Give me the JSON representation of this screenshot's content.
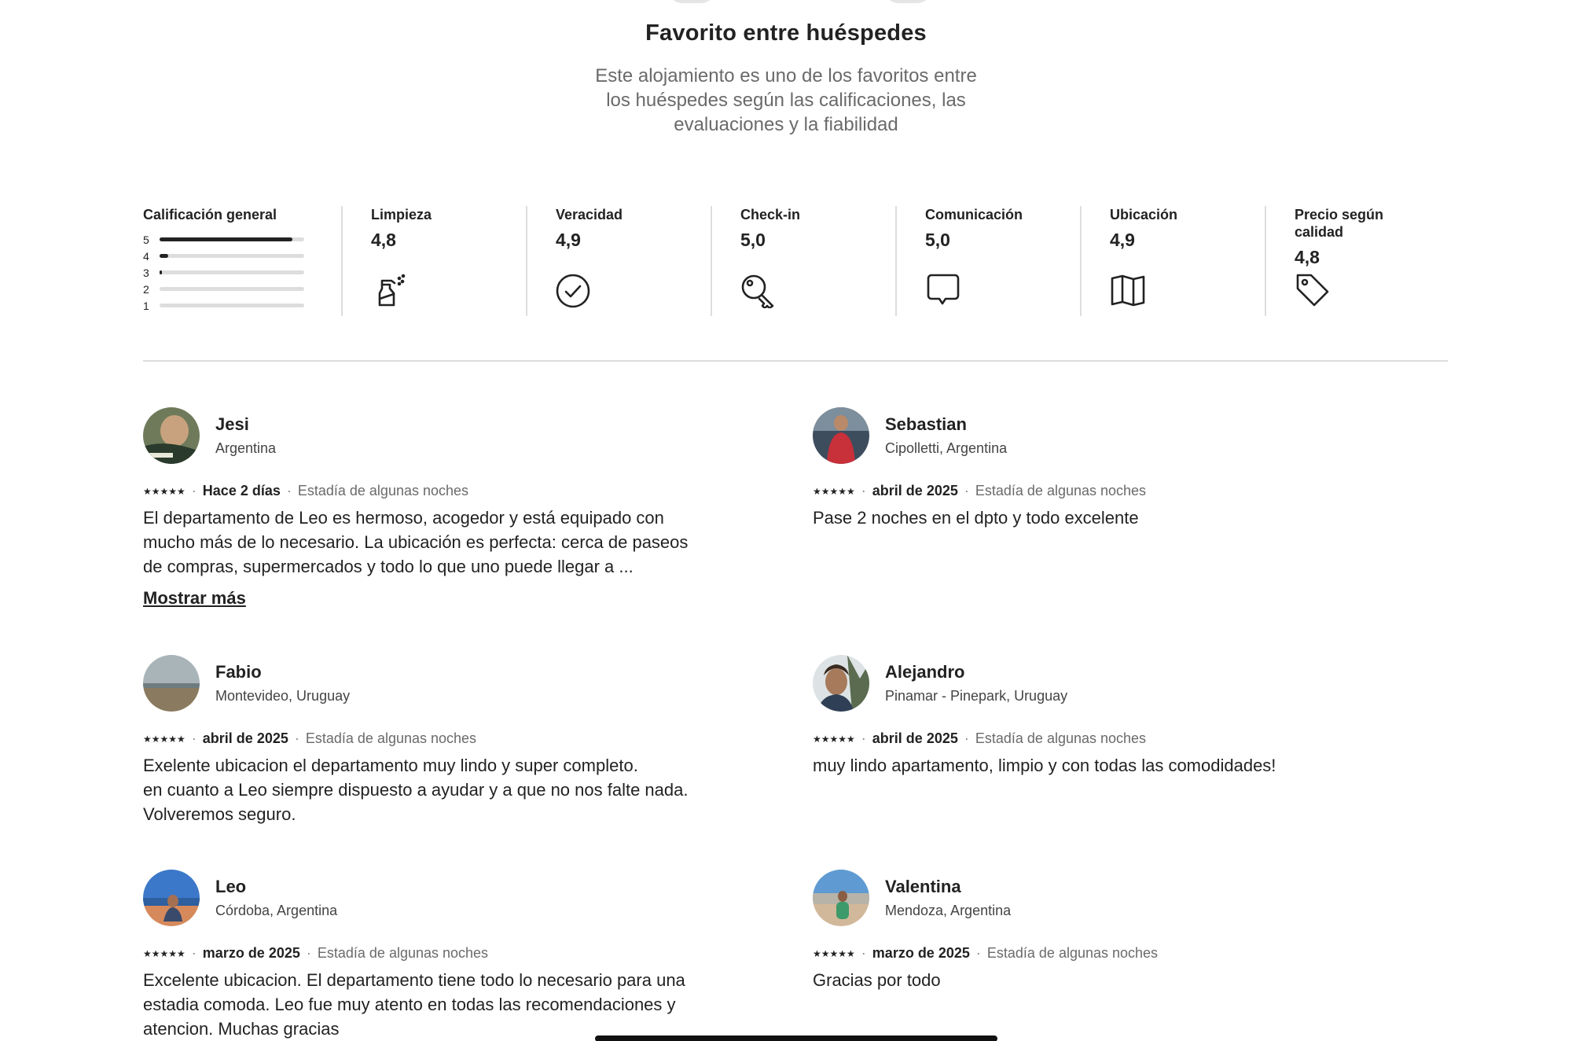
{
  "hero": {
    "title": "Favorito entre huéspedes",
    "subtitle": "Este alojamiento es uno de los favoritos entre los huéspedes según las calificaciones, las evaluaciones y la fiabilidad"
  },
  "overall": {
    "label": "Calificación general",
    "bars": [
      {
        "stars": "5",
        "fraction": 0.92
      },
      {
        "stars": "4",
        "fraction": 0.06
      },
      {
        "stars": "3",
        "fraction": 0.015
      },
      {
        "stars": "2",
        "fraction": 0.0
      },
      {
        "stars": "1",
        "fraction": 0.0
      }
    ]
  },
  "categories": [
    {
      "label": "Limpieza",
      "value": "4,8",
      "icon": "spray-bottle-icon"
    },
    {
      "label": "Veracidad",
      "value": "4,9",
      "icon": "check-circle-icon"
    },
    {
      "label": "Check-in",
      "value": "5,0",
      "icon": "key-icon"
    },
    {
      "label": "Comunicación",
      "value": "5,0",
      "icon": "chat-bubble-icon"
    },
    {
      "label": "Ubicación",
      "value": "4,9",
      "icon": "map-icon"
    },
    {
      "label": "Precio según calidad",
      "value": "4,8",
      "icon": "price-tag-icon"
    }
  ],
  "reviews": [
    {
      "name": "Jesi",
      "location": "Argentina",
      "stars": "★★★★★",
      "date": "Hace 2 días",
      "stay": "Estadía de algunas noches",
      "text": "El departamento de Leo es hermoso, acogedor y está equipado con mucho más de lo necesario. La ubicación es perfecta: cerca de paseos de compras, supermercados y todo lo que uno puede llegar a ...",
      "show_more": "Mostrar más"
    },
    {
      "name": "Sebastian",
      "location": "Cipolletti, Argentina",
      "stars": "★★★★★",
      "date": "abril de 2025",
      "stay": "Estadía de algunas noches",
      "text": "Pase 2 noches en el dpto y todo excelente"
    },
    {
      "name": "Fabio",
      "location": "Montevideo, Uruguay",
      "stars": "★★★★★",
      "date": "abril de 2025",
      "stay": "Estadía de algunas noches",
      "text": "Exelente ubicacion el departamento muy lindo y super completo.\nen cuanto a Leo siempre dispuesto a ayudar y a que no nos falte nada.\nVolveremos seguro."
    },
    {
      "name": "Alejandro",
      "location": "Pinamar - Pinepark, Uruguay",
      "stars": "★★★★★",
      "date": "abril de 2025",
      "stay": "Estadía de algunas noches",
      "text": "muy lindo apartamento, limpio y con todas las comodidades!"
    },
    {
      "name": "Leo",
      "location": "Córdoba, Argentina",
      "stars": "★★★★★",
      "date": "marzo de 2025",
      "stay": "Estadía de algunas noches",
      "text": "Excelente ubicacion. El departamento tiene todo lo necesario para una estadia comoda. Leo fue muy atento en todas las recomendaciones y atencion. Muchas gracias"
    },
    {
      "name": "Valentina",
      "location": "Mendoza, Argentina",
      "stars": "★★★★★",
      "date": "marzo de 2025",
      "stay": "Estadía de algunas noches",
      "text": "Gracias por todo"
    }
  ],
  "colors": {
    "text": "#222222",
    "muted": "#6a6a6a",
    "divider": "#dddddd"
  }
}
